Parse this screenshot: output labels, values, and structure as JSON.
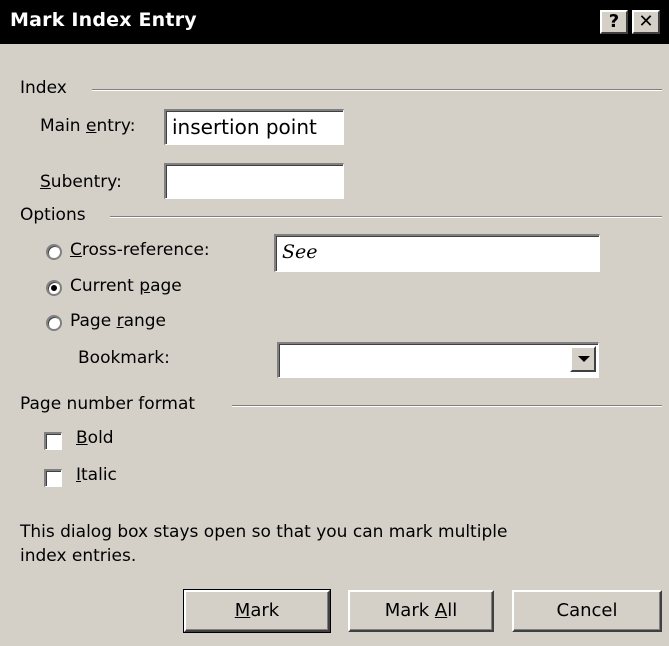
{
  "dialog": {
    "title": "Mark Index Entry",
    "help_label": "?",
    "close_label": "✕"
  },
  "index_group": {
    "label": "Index",
    "main_entry": {
      "label_pre": "Main ",
      "label_accel": "e",
      "label_post": "ntry:",
      "value": "insertion point"
    },
    "subentry": {
      "label_accel": "S",
      "label_post": "ubentry:",
      "value": ""
    }
  },
  "options_group": {
    "label": "Options",
    "cross_reference": {
      "label_accel": "C",
      "label_post": "ross-reference:",
      "value": "See",
      "selected": false
    },
    "current_page": {
      "label_pre": "Current ",
      "label_accel": "p",
      "label_post": "age",
      "selected": true
    },
    "page_range": {
      "label_pre": "Page ",
      "label_accel": "r",
      "label_post": "ange",
      "selected": false
    },
    "bookmark": {
      "label": "Bookmark:",
      "value": ""
    }
  },
  "page_number_format_group": {
    "label": "Page number format",
    "bold": {
      "label_accel": "B",
      "label_post": "old",
      "checked": false
    },
    "italic": {
      "label_accel": "I",
      "label_post": "talic",
      "checked": false
    }
  },
  "info_text_line1": "This dialog box stays open so that you can mark multiple",
  "info_text_line2": "index entries.",
  "buttons": {
    "mark": {
      "label_accel": "M",
      "label_post": "ark"
    },
    "mark_all": {
      "label_pre": "Mark ",
      "label_accel": "A",
      "label_post": "ll"
    },
    "cancel": {
      "label": "Cancel"
    }
  },
  "colors": {
    "titlebar": "#000000",
    "face": "#d4d0c8"
  },
  "icons": {
    "dropdown": "chevron-down-icon",
    "help": "help-icon",
    "close": "close-icon"
  }
}
